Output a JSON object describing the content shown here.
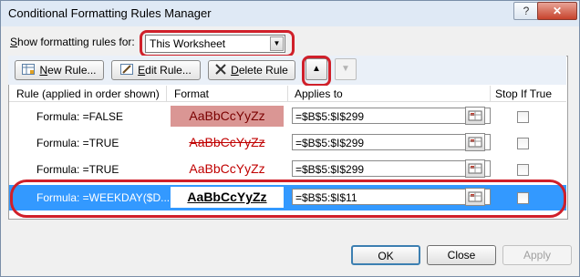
{
  "window": {
    "title": "Conditional Formatting Rules Manager",
    "help_glyph": "?",
    "close_glyph": "✕"
  },
  "show_rules": {
    "label_prefix": "",
    "label_u": "S",
    "label_rest": "how formatting rules for:",
    "selected": "This Worksheet"
  },
  "toolbar": {
    "new_rule_u": "N",
    "new_rule_rest": "ew Rule...",
    "edit_rule_u": "E",
    "edit_rule_rest": "dit Rule...",
    "delete_rule_u": "D",
    "delete_rule_rest": "elete Rule",
    "move_up_glyph": "▲",
    "move_down_glyph": "▼"
  },
  "table": {
    "headers": {
      "rule": "Rule (applied in order shown)",
      "format": "Format",
      "applies_to": "Applies to",
      "stop_if_true": "Stop If True"
    },
    "rows": [
      {
        "rule": "Formula: =FALSE",
        "format_preview": "AaBbCcYyZz",
        "applies_to": "=$B$5:$I$299",
        "stop_if_true": false
      },
      {
        "rule": "Formula: =TRUE",
        "format_preview": "AaBbCcYyZz",
        "applies_to": "=$B$5:$I$299",
        "stop_if_true": false
      },
      {
        "rule": "Formula: =TRUE",
        "format_preview": "AaBbCcYyZz",
        "applies_to": "=$B$5:$I$299",
        "stop_if_true": false
      },
      {
        "rule": "Formula: =WEEKDAY($D...",
        "format_preview": "AaBbCcYyZz",
        "applies_to": "=$B$5:$I$11",
        "stop_if_true": false,
        "selected": true
      }
    ]
  },
  "footer": {
    "ok": "OK",
    "close": "Close",
    "apply": "Apply"
  },
  "colors": {
    "annotation_red": "#d0202a",
    "selection_blue": "#3399ff",
    "row1_fill": "#da9694",
    "strike_red": "#c00000"
  }
}
